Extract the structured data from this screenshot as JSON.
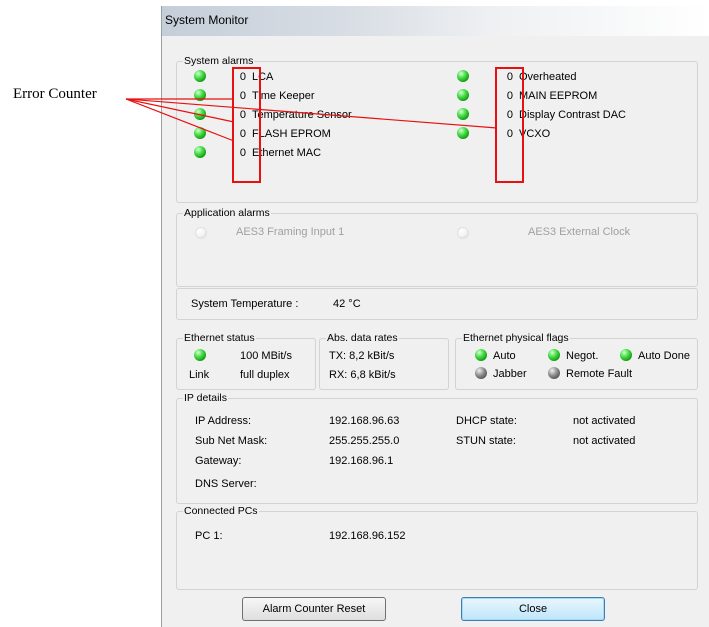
{
  "window": {
    "title": "System Monitor"
  },
  "system_alarms": {
    "legend": "System alarms",
    "left": [
      {
        "count": "0",
        "label": "LCA"
      },
      {
        "count": "0",
        "label": "Time Keeper"
      },
      {
        "count": "0",
        "label": "Temperature Sensor"
      },
      {
        "count": "0",
        "label": "FLASH EPROM"
      },
      {
        "count": "0",
        "label": "Ethernet MAC"
      }
    ],
    "right": [
      {
        "count": "0",
        "label": "Overheated"
      },
      {
        "count": "0",
        "label": "MAIN EEPROM"
      },
      {
        "count": "0",
        "label": "Display Contrast DAC"
      },
      {
        "count": "0",
        "label": "VCXO"
      }
    ]
  },
  "application_alarms": {
    "legend": "Application alarms",
    "items": [
      "AES3 Framing Input 1",
      "AES3 External Clock"
    ]
  },
  "temperature": {
    "label": "System Temperature :",
    "value": "42 °C"
  },
  "ethernet_status": {
    "legend": "Ethernet status",
    "speed": "100 MBit/s",
    "link": "Link",
    "duplex": "full duplex"
  },
  "data_rates": {
    "legend": "Abs. data rates",
    "tx": "TX: 8,2 kBit/s",
    "rx": "RX: 6,8 kBit/s"
  },
  "physical_flags": {
    "legend": "Ethernet physical flags",
    "auto": "Auto",
    "negot": "Negot.",
    "auto_done": "Auto Done",
    "jabber": "Jabber",
    "remote_fault": "Remote Fault"
  },
  "ip_details": {
    "legend": "IP details",
    "ip_label": "IP Address:",
    "ip_value": "192.168.96.63",
    "mask_label": "Sub Net Mask:",
    "mask_value": "255.255.255.0",
    "gateway_label": "Gateway:",
    "gateway_value": "192.168.96.1",
    "dns_label": "DNS Server:",
    "dhcp_label": "DHCP state:",
    "dhcp_value": "not activated",
    "stun_label": "STUN state:",
    "stun_value": "not activated"
  },
  "connected_pcs": {
    "legend": "Connected PCs",
    "pc_label": "PC 1:",
    "pc_value": "192.168.96.152"
  },
  "buttons": {
    "reset": "Alarm Counter Reset",
    "close": "Close"
  },
  "annotation": {
    "label": "Error Counter"
  },
  "colors": {
    "led_on": "#22c322",
    "led_off": "#7a7a7a",
    "annotation": "#e81010",
    "primary_button": "#bee6fd"
  }
}
